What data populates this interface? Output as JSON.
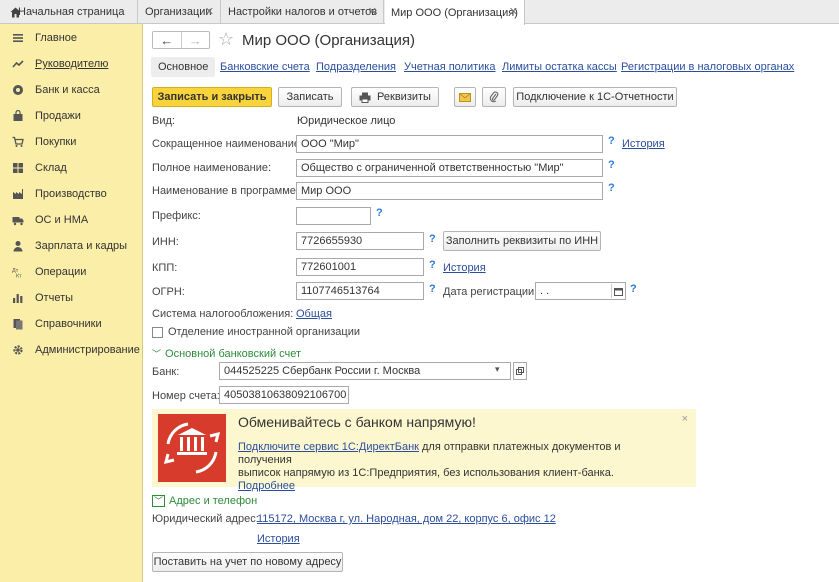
{
  "tabs": {
    "home": "Начальная страница",
    "items": [
      {
        "label": "Организации"
      },
      {
        "label": "Настройки налогов и отчетов"
      },
      {
        "label": "Мир ООО (Организация)"
      }
    ]
  },
  "sidebar": {
    "items": [
      {
        "label": "Главное",
        "icon": "menu-icon"
      },
      {
        "label": "Руководителю",
        "icon": "trend-icon"
      },
      {
        "label": "Банк и касса",
        "icon": "coin-icon"
      },
      {
        "label": "Продажи",
        "icon": "bag-icon"
      },
      {
        "label": "Покупки",
        "icon": "cart-icon"
      },
      {
        "label": "Склад",
        "icon": "warehouse-icon"
      },
      {
        "label": "Производство",
        "icon": "factory-icon"
      },
      {
        "label": "ОС и НМА",
        "icon": "truck-icon"
      },
      {
        "label": "Зарплата и кадры",
        "icon": "person-icon"
      },
      {
        "label": "Операции",
        "icon": "operations-icon"
      },
      {
        "label": "Отчеты",
        "icon": "chart-icon"
      },
      {
        "label": "Справочники",
        "icon": "books-icon"
      },
      {
        "label": "Администрирование",
        "icon": "gear-icon"
      }
    ]
  },
  "header": {
    "title": "Мир ООО (Организация)"
  },
  "subtabs": {
    "main": "Основное",
    "bank_accounts": "Банковские счета",
    "divisions": "Подразделения",
    "accounting_policy": "Учетная политика",
    "cash_limits": "Лимиты остатка кассы",
    "tax_registrations": "Регистрации в налоговых органах"
  },
  "toolbar": {
    "save_close": "Записать и закрыть",
    "save": "Записать",
    "requisites": "Реквизиты",
    "connect": "Подключение к 1С-Отчетности"
  },
  "form": {
    "kind_label": "Вид:",
    "kind_value": "Юридическое лицо",
    "short_name_label": "Сокращенное наименование:",
    "short_name_value": "ООО \"Мир\"",
    "full_name_label": "Полное наименование:",
    "full_name_value": "Общество с ограниченной ответственностью \"Мир\"",
    "program_name_label": "Наименование в программе:",
    "program_name_value": "Мир ООО",
    "prefix_label": "Префикс:",
    "prefix_value": "",
    "inn_label": "ИНН:",
    "inn_value": "7726655930",
    "fill_by_inn": "Заполнить реквизиты по ИНН",
    "kpp_label": "КПП:",
    "kpp_value": "772601001",
    "ogrn_label": "ОГРН:",
    "ogrn_value": "1107746513764",
    "reg_date_label": "Дата регистрации:",
    "reg_date_value": " .  .",
    "tax_system_label": "Система налогообложения:",
    "tax_system_value": "Общая",
    "foreign_branch_label": "Отделение иностранной организации",
    "history": "История",
    "help": "?"
  },
  "bank_section": {
    "title": "Основной банковский счет",
    "bank_label": "Банк:",
    "bank_value": "044525225 Сбербанк России г. Москва",
    "account_label": "Номер счета:",
    "account_value": "40503810638092106700"
  },
  "banner": {
    "title": "Обменивайтесь с банком напрямую!",
    "link": "Подключите сервис 1С:ДиректБанк",
    "text1": " для отправки платежных документов и получения",
    "text2": "выписок напрямую из 1С:Предприятия, без использования клиент-банка. ",
    "more": "Подробнее",
    "close": "×"
  },
  "address_section": {
    "title": "Адрес и телефон",
    "legal_label": "Юридический адрес:",
    "legal_value": "115172, Москва г, ул. Народная, дом 22, корпус 6, офис 12",
    "history": "История",
    "register_btn": "Поставить на учет по новому адресу"
  }
}
